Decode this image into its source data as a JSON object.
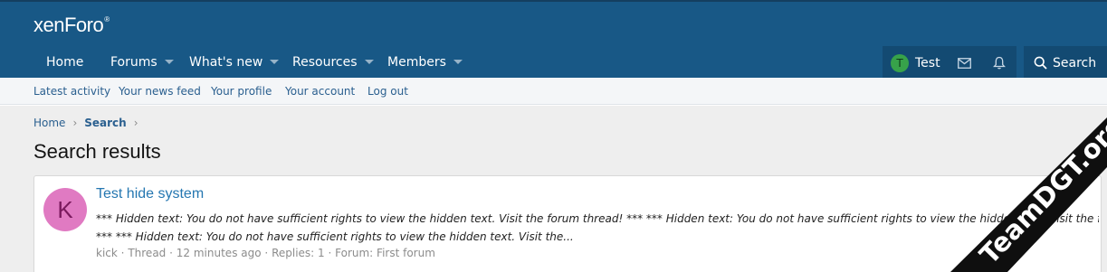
{
  "logo": {
    "text": "xenForo",
    "mark": "®"
  },
  "nav": {
    "items": [
      {
        "label": "Home",
        "has_caret": false
      },
      {
        "label": "Forums",
        "has_caret": true
      },
      {
        "label": "What's new",
        "has_caret": true
      },
      {
        "label": "Resources",
        "has_caret": true
      },
      {
        "label": "Members",
        "has_caret": true
      }
    ],
    "user": {
      "initial": "T",
      "name": "Test"
    },
    "search_label": "Search"
  },
  "subnav": {
    "items": [
      "Latest activity",
      "Your news feed",
      "Your profile",
      "Your account",
      "Log out"
    ]
  },
  "breadcrumb": {
    "home": "Home",
    "current": "Search"
  },
  "page_title": "Search results",
  "result": {
    "avatar_initial": "K",
    "title": "Test hide system",
    "snippet_line1": "*** Hidden text: You do not have sufficient rights to view the hidden text. Visit the forum thread! *** *** Hidden text: You do not have sufficient rights to view the hidden text. Visit the forum thread!",
    "snippet_line2": "*** *** Hidden text: You do not have sufficient rights to view the hidden text. Visit the...",
    "author": "kick",
    "type": "Thread",
    "time": "12 minutes ago",
    "replies": "Replies: 1",
    "forum": "Forum: First forum",
    "separator": "·"
  },
  "watermark": {
    "text": "TeamDGT.org"
  },
  "colors": {
    "header": "#185886",
    "nav_dark": "#134a72",
    "link": "#2577b1",
    "avatar_k": "#e07ac2",
    "avatar_t": "#37a24a"
  }
}
